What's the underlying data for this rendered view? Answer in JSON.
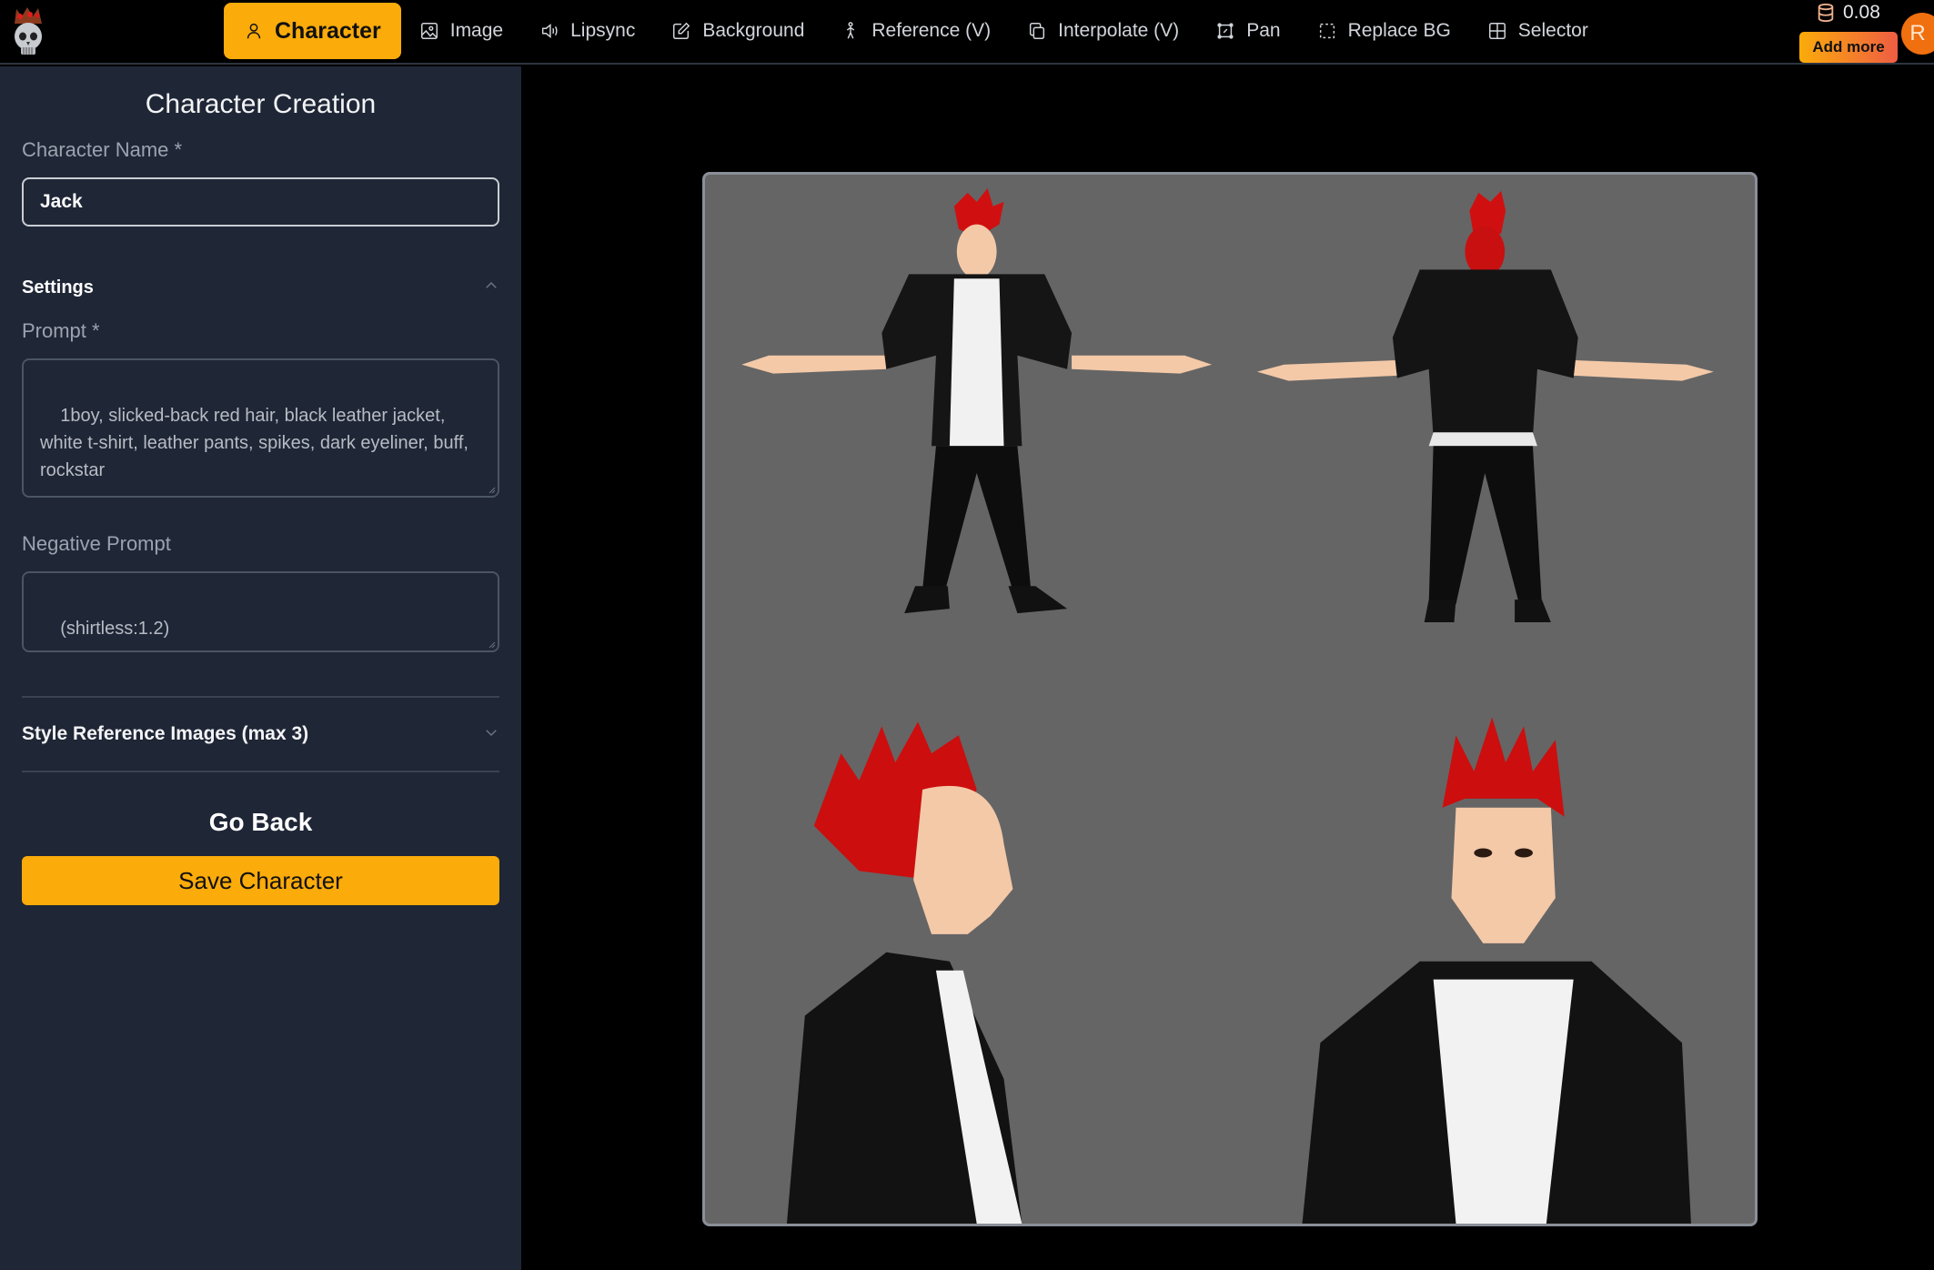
{
  "app": {
    "logo": "crowned-skull-logo"
  },
  "nav": {
    "items": [
      {
        "label": "Character",
        "icon": "user-icon",
        "active": true
      },
      {
        "label": "Image",
        "icon": "image-icon"
      },
      {
        "label": "Lipsync",
        "icon": "speaker-icon"
      },
      {
        "label": "Background",
        "icon": "edit-icon"
      },
      {
        "label": "Reference (V)",
        "icon": "walking-person-icon"
      },
      {
        "label": "Interpolate (V)",
        "icon": "copy-icon"
      },
      {
        "label": "Pan",
        "icon": "frame-icon"
      },
      {
        "label": "Replace BG",
        "icon": "dashed-select-icon"
      },
      {
        "label": "Selector",
        "icon": "grid-icon"
      }
    ]
  },
  "account": {
    "credits": "0.08",
    "add_more_label": "Add more",
    "avatar_initial": "R"
  },
  "sidebar": {
    "title": "Character Creation",
    "name_label": "Character Name *",
    "name_value": "Jack",
    "settings_label": "Settings",
    "prompt_label": "Prompt *",
    "prompt_value": "1boy, slicked-back red hair, black leather jacket, white t-shirt, leather pants, spikes, dark eyeliner, buff, rockstar",
    "negative_label": "Negative Prompt",
    "negative_value": "(shirtless:1.2)",
    "style_ref_label": "Style Reference Images (max 3)",
    "go_back_label": "Go Back",
    "save_label": "Save Character"
  },
  "preview": {
    "description": "Character reference sheet: front view, back view, side profile, front portrait",
    "background_color": "#656565"
  },
  "colors": {
    "accent": "#fbab0a",
    "sidebar_bg": "#1f2636",
    "gradient_end": "#ef5d43",
    "avatar": "#f06f0f"
  }
}
